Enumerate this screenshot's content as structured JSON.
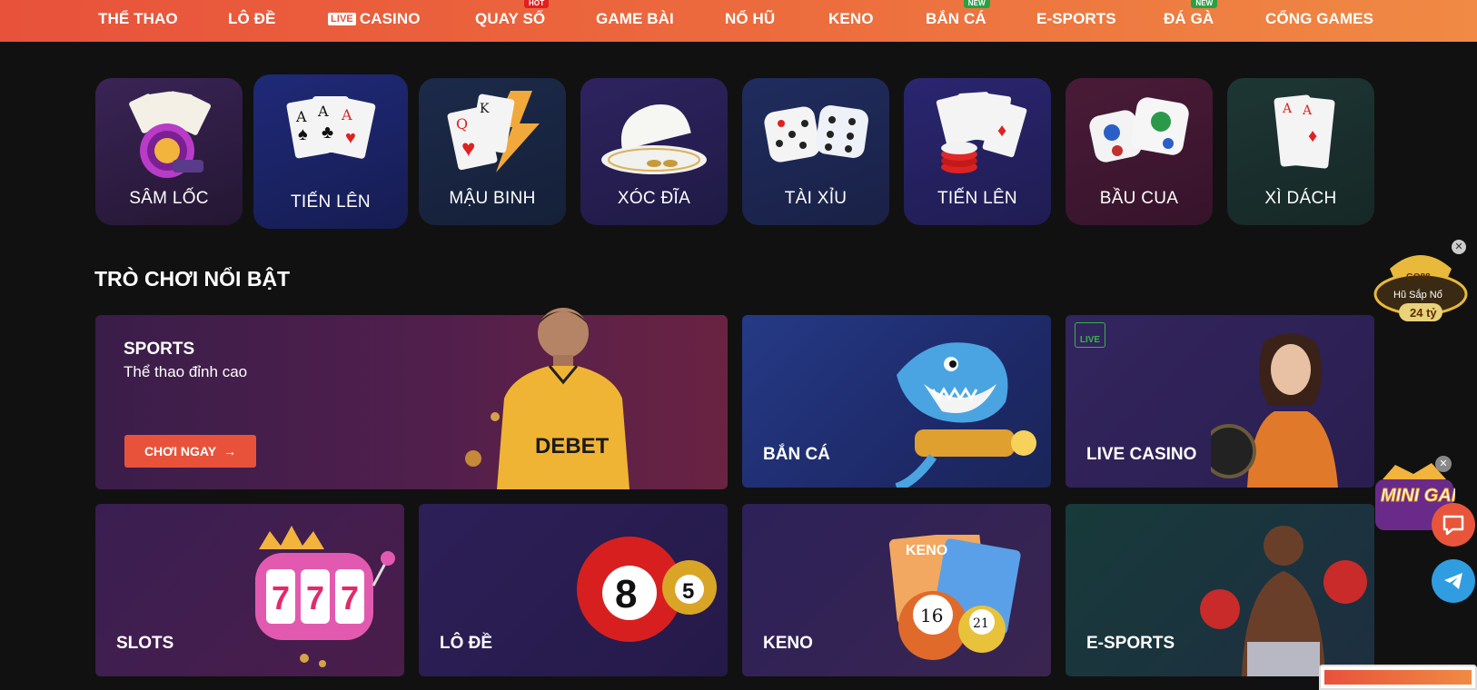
{
  "nav": {
    "items": [
      {
        "label": "THỂ THAO"
      },
      {
        "label": "LÔ ĐỀ"
      },
      {
        "label": "CASINO",
        "tag": "LIVE"
      },
      {
        "label": "QUAY SỐ",
        "badge": "HOT"
      },
      {
        "label": "GAME BÀI"
      },
      {
        "label": "NỔ HŨ"
      },
      {
        "label": "KENO"
      },
      {
        "label": "BẮN CÁ",
        "badge": "NEW"
      },
      {
        "label": "E-SPORTS"
      },
      {
        "label": "ĐÁ GÀ",
        "badge": "NEW"
      },
      {
        "label": "CỔNG GAMES"
      }
    ]
  },
  "card_games": [
    {
      "label": "SÂM LỐC",
      "icon": "chip-cards-icon"
    },
    {
      "label": "TIẾN LÊN",
      "icon": "three-aces-icon"
    },
    {
      "label": "MẬU BINH",
      "icon": "cards-lightning-icon"
    },
    {
      "label": "XÓC ĐĨA",
      "icon": "bowl-plate-icon"
    },
    {
      "label": "TÀI XỈU",
      "icon": "dice-icon"
    },
    {
      "label": "TIẾN LÊN",
      "icon": "cards-chips-icon"
    },
    {
      "label": "BẦU CUA",
      "icon": "animal-dice-icon"
    },
    {
      "label": "XÌ DÁCH",
      "icon": "two-aces-icon"
    }
  ],
  "featured": {
    "title": "TRÒ CHƠI NỔI BẬT",
    "sports": {
      "title": "SPORTS",
      "subtitle": "Thể thao đỉnh cao",
      "button": "CHƠI NGAY",
      "jersey": "DEBET"
    },
    "tiles": {
      "ban_ca": "BẮN CÁ",
      "live_casino": "LIVE CASINO",
      "live_icon": "LIVE",
      "slots": "SLOTS",
      "lo_de": "LÔ ĐỀ",
      "keno": "KENO",
      "esports": "E-SPORTS"
    },
    "ball_8": "8",
    "ball_5": "5",
    "keno_card": "KENO",
    "keno_16": "16",
    "keno_21": "21"
  },
  "floating": {
    "jackpot_brand": "GO88",
    "jackpot_text": "Hũ Sắp Nổ",
    "jackpot_amount": "24 tỷ",
    "minigame": "MINI GAME"
  },
  "colors": {
    "accent": "#e8523b",
    "bg": "#111111"
  }
}
